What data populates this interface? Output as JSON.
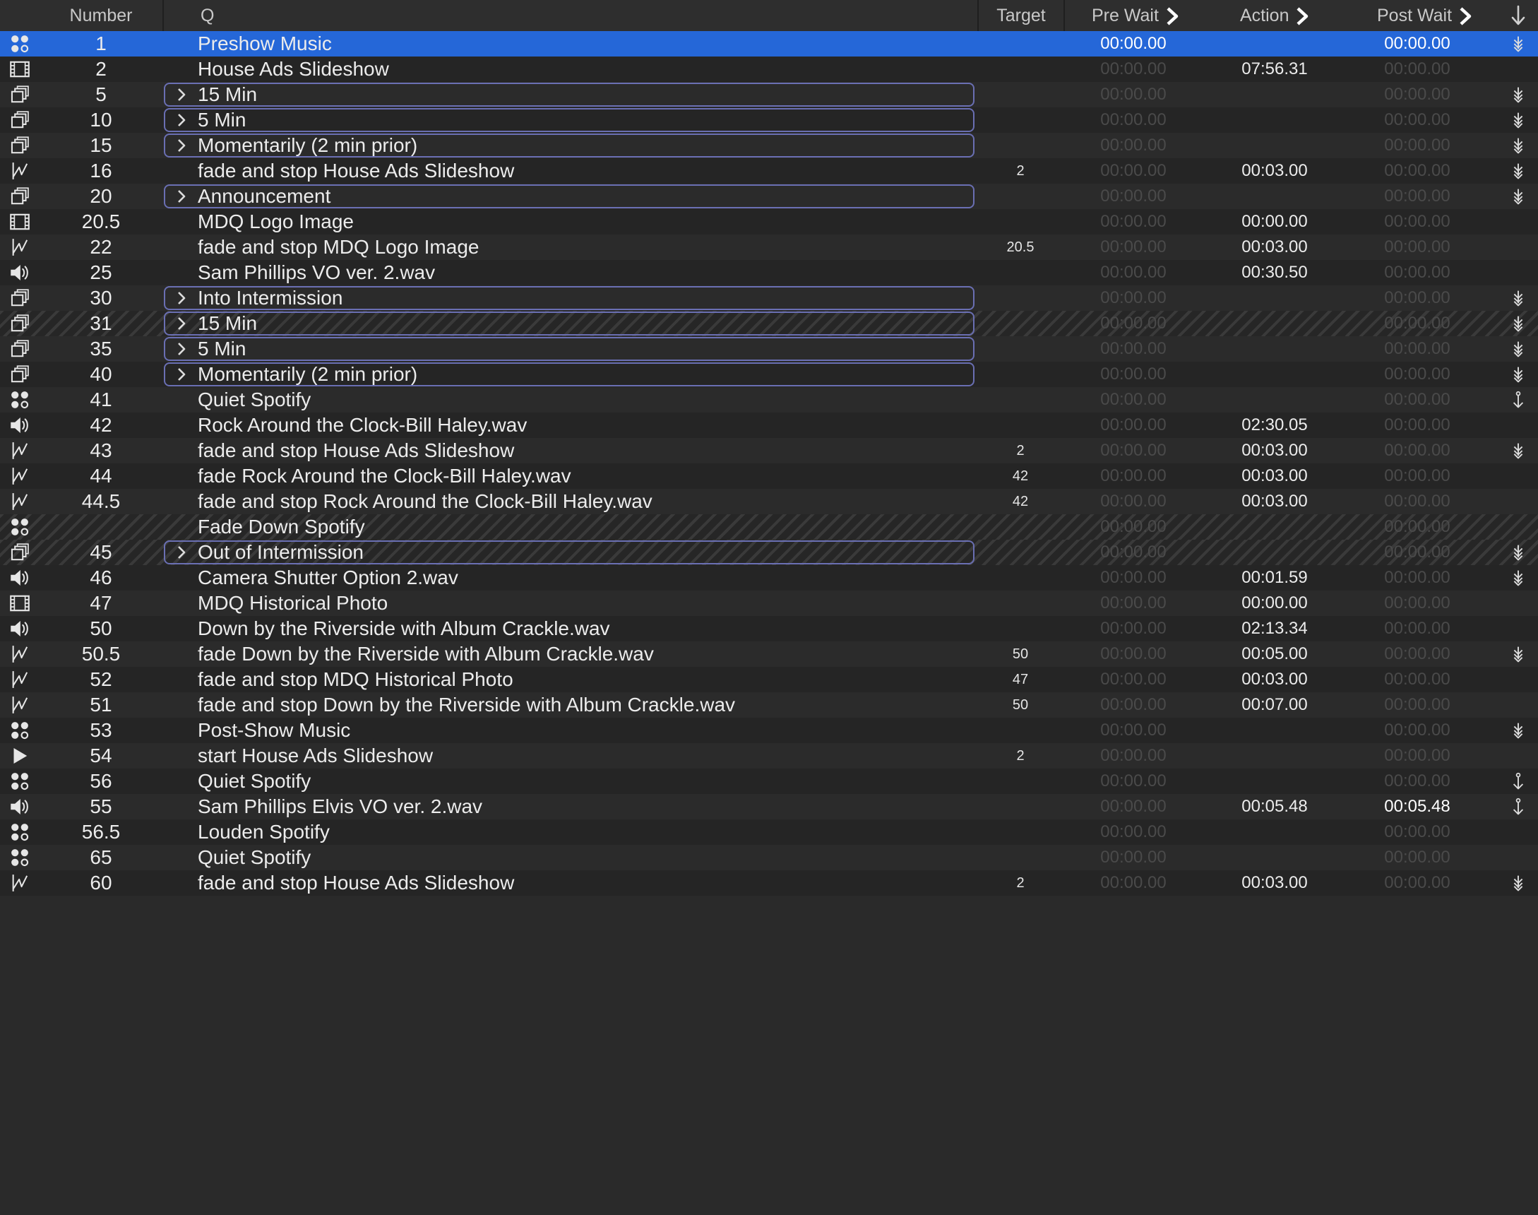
{
  "header": {
    "number": "Number",
    "q": "Q",
    "target": "Target",
    "pre_wait": "Pre Wait",
    "action": "Action",
    "post_wait": "Post Wait"
  },
  "colors": {
    "selection": "#2567d8",
    "group_border": "#6a6fb3",
    "row_even": "#2b2b2b",
    "row_odd": "#252525",
    "dim_time": "#4a4a4a"
  },
  "rows": [
    {
      "type": "network",
      "number": "1",
      "name": "Preshow Music",
      "target": "",
      "pre": "00:00.00",
      "act": "",
      "post": "00:00.00",
      "cont": "auto",
      "selected": true,
      "group": false,
      "broken": false
    },
    {
      "type": "video",
      "number": "2",
      "name": "House Ads Slideshow",
      "target": "",
      "pre": "00:00.00",
      "act": "07:56.31",
      "post": "00:00.00",
      "cont": "",
      "selected": false,
      "group": false,
      "broken": false
    },
    {
      "type": "group",
      "number": "5",
      "name": "15 Min",
      "target": "",
      "pre": "00:00.00",
      "act": "",
      "post": "00:00.00",
      "cont": "auto",
      "selected": false,
      "group": true,
      "broken": false
    },
    {
      "type": "group",
      "number": "10",
      "name": "5 Min",
      "target": "",
      "pre": "00:00.00",
      "act": "",
      "post": "00:00.00",
      "cont": "auto",
      "selected": false,
      "group": true,
      "broken": false
    },
    {
      "type": "group",
      "number": "15",
      "name": "Momentarily (2 min prior)",
      "target": "",
      "pre": "00:00.00",
      "act": "",
      "post": "00:00.00",
      "cont": "auto",
      "selected": false,
      "group": true,
      "broken": false
    },
    {
      "type": "fade",
      "number": "16",
      "name": "fade and stop House Ads Slideshow",
      "target": "2",
      "pre": "00:00.00",
      "act": "00:03.00",
      "post": "00:00.00",
      "cont": "auto",
      "selected": false,
      "group": false,
      "broken": false
    },
    {
      "type": "group",
      "number": "20",
      "name": "Announcement",
      "target": "",
      "pre": "00:00.00",
      "act": "",
      "post": "00:00.00",
      "cont": "auto",
      "selected": false,
      "group": true,
      "broken": false
    },
    {
      "type": "video",
      "number": "20.5",
      "name": "MDQ Logo Image",
      "target": "",
      "pre": "00:00.00",
      "act": "00:00.00",
      "post": "00:00.00",
      "cont": "",
      "selected": false,
      "group": false,
      "broken": false
    },
    {
      "type": "fade",
      "number": "22",
      "name": "fade and stop MDQ Logo Image",
      "target": "20.5",
      "pre": "00:00.00",
      "act": "00:03.00",
      "post": "00:00.00",
      "cont": "",
      "selected": false,
      "group": false,
      "broken": false
    },
    {
      "type": "audio",
      "number": "25",
      "name": "Sam Phillips VO ver. 2.wav",
      "target": "",
      "pre": "00:00.00",
      "act": "00:30.50",
      "post": "00:00.00",
      "cont": "",
      "selected": false,
      "group": false,
      "broken": false
    },
    {
      "type": "group",
      "number": "30",
      "name": "Into Intermission",
      "target": "",
      "pre": "00:00.00",
      "act": "",
      "post": "00:00.00",
      "cont": "auto",
      "selected": false,
      "group": true,
      "broken": false
    },
    {
      "type": "group",
      "number": "31",
      "name": "15 Min",
      "target": "",
      "pre": "00:00.00",
      "act": "",
      "post": "00:00.00",
      "cont": "auto",
      "selected": false,
      "group": true,
      "broken": true
    },
    {
      "type": "group",
      "number": "35",
      "name": "5 Min",
      "target": "",
      "pre": "00:00.00",
      "act": "",
      "post": "00:00.00",
      "cont": "auto",
      "selected": false,
      "group": true,
      "broken": false
    },
    {
      "type": "group",
      "number": "40",
      "name": "Momentarily (2 min prior)",
      "target": "",
      "pre": "00:00.00",
      "act": "",
      "post": "00:00.00",
      "cont": "auto",
      "selected": false,
      "group": true,
      "broken": false
    },
    {
      "type": "network",
      "number": "41",
      "name": "Quiet Spotify",
      "target": "",
      "pre": "00:00.00",
      "act": "",
      "post": "00:00.00",
      "cont": "follow",
      "selected": false,
      "group": false,
      "broken": false
    },
    {
      "type": "audio",
      "number": "42",
      "name": "Rock Around the Clock-Bill Haley.wav",
      "target": "",
      "pre": "00:00.00",
      "act": "02:30.05",
      "post": "00:00.00",
      "cont": "",
      "selected": false,
      "group": false,
      "broken": false
    },
    {
      "type": "fade",
      "number": "43",
      "name": "fade and stop House Ads Slideshow",
      "target": "2",
      "pre": "00:00.00",
      "act": "00:03.00",
      "post": "00:00.00",
      "cont": "auto",
      "selected": false,
      "group": false,
      "broken": false
    },
    {
      "type": "fade",
      "number": "44",
      "name": "fade Rock Around the Clock-Bill Haley.wav",
      "target": "42",
      "pre": "00:00.00",
      "act": "00:03.00",
      "post": "00:00.00",
      "cont": "",
      "selected": false,
      "group": false,
      "broken": false
    },
    {
      "type": "fade",
      "number": "44.5",
      "name": "fade and stop Rock Around the Clock-Bill Haley.wav",
      "target": "42",
      "pre": "00:00.00",
      "act": "00:03.00",
      "post": "00:00.00",
      "cont": "",
      "selected": false,
      "group": false,
      "broken": false
    },
    {
      "type": "network",
      "number": "",
      "name": "Fade Down Spotify",
      "target": "",
      "pre": "00:00.00",
      "act": "",
      "post": "00:00.00",
      "cont": "",
      "selected": false,
      "group": false,
      "broken": true
    },
    {
      "type": "group",
      "number": "45",
      "name": "Out of Intermission",
      "target": "",
      "pre": "00:00.00",
      "act": "",
      "post": "00:00.00",
      "cont": "auto",
      "selected": false,
      "group": true,
      "broken": true
    },
    {
      "type": "audio",
      "number": "46",
      "name": "Camera Shutter Option 2.wav",
      "target": "",
      "pre": "00:00.00",
      "act": "00:01.59",
      "post": "00:00.00",
      "cont": "auto",
      "selected": false,
      "group": false,
      "broken": false
    },
    {
      "type": "video",
      "number": "47",
      "name": "MDQ Historical Photo",
      "target": "",
      "pre": "00:00.00",
      "act": "00:00.00",
      "post": "00:00.00",
      "cont": "",
      "selected": false,
      "group": false,
      "broken": false
    },
    {
      "type": "audio",
      "number": "50",
      "name": "Down by the Riverside with Album Crackle.wav",
      "target": "",
      "pre": "00:00.00",
      "act": "02:13.34",
      "post": "00:00.00",
      "cont": "",
      "selected": false,
      "group": false,
      "broken": false
    },
    {
      "type": "fade",
      "number": "50.5",
      "name": "fade Down by the Riverside with Album Crackle.wav",
      "target": "50",
      "pre": "00:00.00",
      "act": "00:05.00",
      "post": "00:00.00",
      "cont": "auto",
      "selected": false,
      "group": false,
      "broken": false
    },
    {
      "type": "fade",
      "number": "52",
      "name": "fade and stop MDQ Historical Photo",
      "target": "47",
      "pre": "00:00.00",
      "act": "00:03.00",
      "post": "00:00.00",
      "cont": "",
      "selected": false,
      "group": false,
      "broken": false
    },
    {
      "type": "fade",
      "number": "51",
      "name": "fade and stop Down by the Riverside with Album Crackle.wav",
      "target": "50",
      "pre": "00:00.00",
      "act": "00:07.00",
      "post": "00:00.00",
      "cont": "",
      "selected": false,
      "group": false,
      "broken": false
    },
    {
      "type": "network",
      "number": "53",
      "name": "Post-Show Music",
      "target": "",
      "pre": "00:00.00",
      "act": "",
      "post": "00:00.00",
      "cont": "auto",
      "selected": false,
      "group": false,
      "broken": false
    },
    {
      "type": "start",
      "number": "54",
      "name": "start House Ads Slideshow",
      "target": "2",
      "pre": "00:00.00",
      "act": "",
      "post": "00:00.00",
      "cont": "",
      "selected": false,
      "group": false,
      "broken": false
    },
    {
      "type": "network",
      "number": "56",
      "name": "Quiet Spotify",
      "target": "",
      "pre": "00:00.00",
      "act": "",
      "post": "00:00.00",
      "cont": "follow",
      "selected": false,
      "group": false,
      "broken": false
    },
    {
      "type": "audio",
      "number": "55",
      "name": "Sam Phillips Elvis VO ver. 2.wav",
      "target": "",
      "pre": "00:00.00",
      "act": "00:05.48",
      "post": "00:05.48",
      "cont": "follow",
      "selected": false,
      "group": false,
      "broken": false,
      "post_active": true
    },
    {
      "type": "network",
      "number": "56.5",
      "name": "Louden Spotify",
      "target": "",
      "pre": "00:00.00",
      "act": "",
      "post": "00:00.00",
      "cont": "",
      "selected": false,
      "group": false,
      "broken": false
    },
    {
      "type": "network",
      "number": "65",
      "name": "Quiet Spotify",
      "target": "",
      "pre": "00:00.00",
      "act": "",
      "post": "00:00.00",
      "cont": "",
      "selected": false,
      "group": false,
      "broken": false
    },
    {
      "type": "fade",
      "number": "60",
      "name": "fade and stop House Ads Slideshow",
      "target": "2",
      "pre": "00:00.00",
      "act": "00:03.00",
      "post": "00:00.00",
      "cont": "auto",
      "selected": false,
      "group": false,
      "broken": false
    }
  ]
}
